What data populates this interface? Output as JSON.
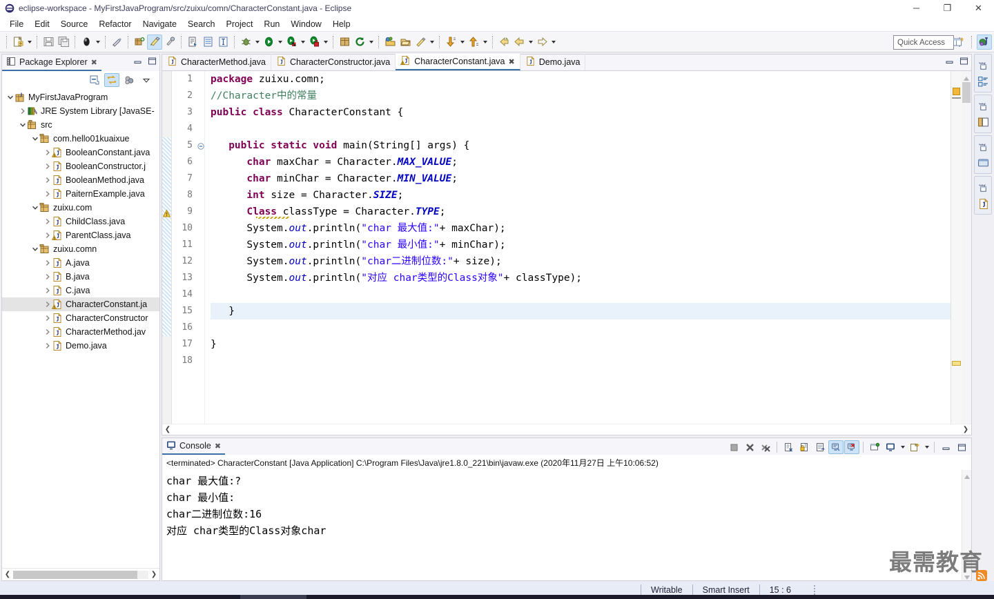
{
  "window": {
    "title": "eclipse-workspace - MyFirstJavaProgram/src/zuixu/comn/CharacterConstant.java - Eclipse",
    "app_icon": "eclipse-icon",
    "minimize_label": "─",
    "maximize_label": "❐",
    "close_label": "✕"
  },
  "menubar": {
    "items": [
      "File",
      "Edit",
      "Source",
      "Refactor",
      "Navigate",
      "Search",
      "Project",
      "Run",
      "Window",
      "Help"
    ]
  },
  "toolbar": {
    "quick_access_placeholder": "Quick Access",
    "groups": [
      {
        "buttons": [
          {
            "name": "new-wizard-icon",
            "caret": true
          }
        ]
      },
      {
        "buttons": [
          {
            "name": "save-icon",
            "caret": false
          },
          {
            "name": "save-all-icon",
            "caret": false
          }
        ]
      },
      {
        "buttons": [
          {
            "name": "print-icon",
            "caret": true
          }
        ]
      },
      {
        "buttons": [
          {
            "name": "toggle-mark-occurrences-icon",
            "caret": false
          }
        ]
      },
      {
        "buttons": [
          {
            "name": "new-java-project-icon",
            "caret": false
          },
          {
            "name": "new-java-class-icon",
            "caret": false,
            "selected": true
          },
          {
            "name": "new-java-package-icon",
            "caret": false
          }
        ]
      },
      {
        "buttons": [
          {
            "name": "open-type-icon",
            "caret": false
          },
          {
            "name": "open-task-icon",
            "caret": false
          },
          {
            "name": "toggle-block-selection-icon",
            "caret": false
          }
        ]
      },
      {
        "buttons": [
          {
            "name": "debug-icon",
            "caret": true
          },
          {
            "name": "run-icon",
            "caret": true
          },
          {
            "name": "run-external-tools-icon",
            "caret": true
          },
          {
            "name": "coverage-icon",
            "caret": true
          }
        ]
      },
      {
        "buttons": [
          {
            "name": "new-package-icon",
            "caret": false
          },
          {
            "name": "refresh-icon",
            "caret": true
          }
        ]
      },
      {
        "buttons": [
          {
            "name": "open-perspective-icon",
            "caret": false
          },
          {
            "name": "open-task-repository-icon",
            "caret": false
          },
          {
            "name": "new-annotation-icon",
            "caret": true
          }
        ]
      },
      {
        "buttons": [
          {
            "name": "next-annotation-icon",
            "caret": true
          },
          {
            "name": "previous-annotation-icon",
            "caret": true
          }
        ]
      },
      {
        "buttons": [
          {
            "name": "back-icon",
            "caret": false
          },
          {
            "name": "previous-edit-icon",
            "caret": true
          },
          {
            "name": "forward-icon",
            "caret": true
          }
        ]
      }
    ],
    "right_buttons": [
      {
        "name": "new-perspective-icon"
      },
      {
        "name": "java-perspective-icon",
        "selected": true
      }
    ]
  },
  "package_explorer": {
    "tab_label": "Package Explorer",
    "tab_icon": "package-explorer-icon",
    "close_icon": "close-icon",
    "minimize_icon": "minimize-icon",
    "maximize_icon": "maximize-icon",
    "toolbar": [
      {
        "name": "collapse-all-icon",
        "selected": false
      },
      {
        "name": "link-with-editor-icon",
        "selected": true
      },
      {
        "name": "focus-on-active-task-icon",
        "selected": false
      },
      {
        "name": "view-menu-icon",
        "selected": false
      }
    ],
    "tree": [
      {
        "depth": 0,
        "arrow": "down",
        "icon": "java-project-icon",
        "label": "MyFirstJavaProgram",
        "selected": false
      },
      {
        "depth": 1,
        "arrow": "right",
        "icon": "library-icon",
        "label": "JRE System Library [JavaSE-",
        "selected": false
      },
      {
        "depth": 1,
        "arrow": "down",
        "icon": "source-folder-icon",
        "label": "src",
        "selected": false
      },
      {
        "depth": 2,
        "arrow": "down",
        "icon": "package-icon",
        "label": "com.hello01kuaixue",
        "selected": false
      },
      {
        "depth": 3,
        "arrow": "right",
        "icon": "java-file-warning-icon",
        "label": "BooleanConstant.java",
        "selected": false
      },
      {
        "depth": 3,
        "arrow": "right",
        "icon": "java-file-icon",
        "label": "BooleanConstructor.j",
        "selected": false
      },
      {
        "depth": 3,
        "arrow": "right",
        "icon": "java-file-icon",
        "label": "BooleanMethod.java",
        "selected": false
      },
      {
        "depth": 3,
        "arrow": "right",
        "icon": "java-file-icon",
        "label": "PaiternExample.java",
        "selected": false
      },
      {
        "depth": 2,
        "arrow": "down",
        "icon": "package-icon",
        "label": "zuixu.com",
        "selected": false
      },
      {
        "depth": 3,
        "arrow": "right",
        "icon": "java-file-icon",
        "label": "ChildClass.java",
        "selected": false
      },
      {
        "depth": 3,
        "arrow": "right",
        "icon": "java-file-warning-icon",
        "label": "ParentClass.java",
        "selected": false
      },
      {
        "depth": 2,
        "arrow": "down",
        "icon": "package-icon",
        "label": "zuixu.comn",
        "selected": false
      },
      {
        "depth": 3,
        "arrow": "right",
        "icon": "java-file-icon",
        "label": "A.java",
        "selected": false
      },
      {
        "depth": 3,
        "arrow": "right",
        "icon": "java-file-icon",
        "label": "B.java",
        "selected": false
      },
      {
        "depth": 3,
        "arrow": "right",
        "icon": "java-file-icon",
        "label": "C.java",
        "selected": false
      },
      {
        "depth": 3,
        "arrow": "right",
        "icon": "java-file-warning-icon",
        "label": "CharacterConstant.ja",
        "selected": true
      },
      {
        "depth": 3,
        "arrow": "right",
        "icon": "java-file-icon",
        "label": "CharacterConstructor",
        "selected": false
      },
      {
        "depth": 3,
        "arrow": "right",
        "icon": "java-file-icon",
        "label": "CharacterMethod.jav",
        "selected": false
      },
      {
        "depth": 3,
        "arrow": "right",
        "icon": "java-file-icon",
        "label": "Demo.java",
        "selected": false
      }
    ],
    "scroll_left_icon": "chevron-left-icon",
    "scroll_right_icon": "chevron-right-icon"
  },
  "editor": {
    "tabs": [
      {
        "label": "CharacterMethod.java",
        "icon": "java-file-icon",
        "active": false,
        "closable": false
      },
      {
        "label": "CharacterConstructor.java",
        "icon": "java-file-icon",
        "active": false,
        "closable": false
      },
      {
        "label": "CharacterConstant.java",
        "icon": "java-file-warning-icon",
        "active": true,
        "closable": true
      },
      {
        "label": "Demo.java",
        "icon": "java-file-icon",
        "active": false,
        "closable": false
      }
    ],
    "close_icon": "close-icon",
    "minimize_icon": "minimize-icon",
    "maximize_icon": "maximize-icon",
    "line_numbers": [
      "1",
      "2",
      "3",
      "4",
      "5",
      "6",
      "7",
      "8",
      "9",
      "10",
      "11",
      "12",
      "13",
      "14",
      "15",
      "16",
      "17",
      "18"
    ],
    "highlighted_line": 15,
    "fold_line": 5,
    "warning_line": 9,
    "lines": [
      {
        "n": 1,
        "tokens": [
          {
            "t": "package ",
            "c": "kw"
          },
          {
            "t": "zuixu.comn;",
            "c": "pl"
          }
        ]
      },
      {
        "n": 2,
        "tokens": [
          {
            "t": "//Character中的常量",
            "c": "cmt"
          }
        ]
      },
      {
        "n": 3,
        "tokens": [
          {
            "t": "public class ",
            "c": "kw"
          },
          {
            "t": "CharacterConstant {",
            "c": "pl"
          }
        ]
      },
      {
        "n": 4,
        "tokens": [
          {
            "t": "",
            "c": "pl"
          }
        ]
      },
      {
        "n": 5,
        "tokens": [
          {
            "t": "   ",
            "c": "pl"
          },
          {
            "t": "public static void ",
            "c": "kw"
          },
          {
            "t": "main(String[] args) {",
            "c": "pl"
          }
        ]
      },
      {
        "n": 6,
        "tokens": [
          {
            "t": "      ",
            "c": "pl"
          },
          {
            "t": "char ",
            "c": "kw"
          },
          {
            "t": "maxChar = Character.",
            "c": "pl"
          },
          {
            "t": "MAX_VALUE",
            "c": "fld"
          },
          {
            "t": ";",
            "c": "pl"
          }
        ]
      },
      {
        "n": 7,
        "tokens": [
          {
            "t": "      ",
            "c": "pl"
          },
          {
            "t": "char ",
            "c": "kw"
          },
          {
            "t": "minChar = Character.",
            "c": "pl"
          },
          {
            "t": "MIN_VALUE",
            "c": "fld"
          },
          {
            "t": ";",
            "c": "pl"
          }
        ]
      },
      {
        "n": 8,
        "tokens": [
          {
            "t": "      ",
            "c": "pl"
          },
          {
            "t": "int ",
            "c": "kw"
          },
          {
            "t": "size = Character.",
            "c": "pl"
          },
          {
            "t": "SIZE",
            "c": "fld"
          },
          {
            "t": ";",
            "c": "pl"
          }
        ]
      },
      {
        "n": 9,
        "tokens": [
          {
            "t": "      ",
            "c": "pl"
          },
          {
            "t": "Class",
            "c": "kw"
          },
          {
            "t": " classType = Character.",
            "c": "pl"
          },
          {
            "t": "TYPE",
            "c": "fld"
          },
          {
            "t": ";",
            "c": "pl"
          }
        ]
      },
      {
        "n": 10,
        "tokens": [
          {
            "t": "      System.",
            "c": "pl"
          },
          {
            "t": "out",
            "c": "sfld"
          },
          {
            "t": ".println(",
            "c": "pl"
          },
          {
            "t": "\"char 最大值:\"",
            "c": "str"
          },
          {
            "t": "+ maxChar);",
            "c": "pl"
          }
        ]
      },
      {
        "n": 11,
        "tokens": [
          {
            "t": "      System.",
            "c": "pl"
          },
          {
            "t": "out",
            "c": "sfld"
          },
          {
            "t": ".println(",
            "c": "pl"
          },
          {
            "t": "\"char 最小值:\"",
            "c": "str"
          },
          {
            "t": "+ minChar);",
            "c": "pl"
          }
        ]
      },
      {
        "n": 12,
        "tokens": [
          {
            "t": "      System.",
            "c": "pl"
          },
          {
            "t": "out",
            "c": "sfld"
          },
          {
            "t": ".println(",
            "c": "pl"
          },
          {
            "t": "\"char二进制位数:\"",
            "c": "str"
          },
          {
            "t": "+ size);",
            "c": "pl"
          }
        ]
      },
      {
        "n": 13,
        "tokens": [
          {
            "t": "      System.",
            "c": "pl"
          },
          {
            "t": "out",
            "c": "sfld"
          },
          {
            "t": ".println(",
            "c": "pl"
          },
          {
            "t": "\"对应 char类型的Class对象\"",
            "c": "str"
          },
          {
            "t": "+ classType);",
            "c": "pl"
          }
        ]
      },
      {
        "n": 14,
        "tokens": [
          {
            "t": "",
            "c": "pl"
          }
        ]
      },
      {
        "n": 15,
        "tokens": [
          {
            "t": "   }",
            "c": "pl"
          }
        ]
      },
      {
        "n": 16,
        "tokens": [
          {
            "t": "",
            "c": "pl"
          }
        ]
      },
      {
        "n": 17,
        "tokens": [
          {
            "t": "}",
            "c": "pl"
          }
        ]
      },
      {
        "n": 18,
        "tokens": [
          {
            "t": "",
            "c": "pl"
          }
        ]
      }
    ]
  },
  "console": {
    "tab_label": "Console",
    "tab_icon": "console-icon",
    "close_icon": "close-icon",
    "terminated_text": "<terminated> CharacterConstant [Java Application] C:\\Program Files\\Java\\jre1.8.0_221\\bin\\javaw.exe (2020年11月27日 上午10:06:52)",
    "toolbar": [
      {
        "name": "terminate-icon",
        "selected": false
      },
      {
        "name": "remove-launch-icon",
        "selected": false
      },
      {
        "name": "remove-all-terminated-icon",
        "selected": false
      },
      {
        "name": "clear-console-icon",
        "selected": false
      },
      {
        "name": "scroll-lock-icon",
        "selected": false
      },
      {
        "name": "word-wrap-icon",
        "selected": false
      },
      {
        "name": "show-console-on-output-icon",
        "selected": true
      },
      {
        "name": "show-console-on-error-icon",
        "selected": true
      },
      {
        "name": "pin-console-icon",
        "selected": false
      },
      {
        "name": "display-selected-console-icon",
        "selected": false
      },
      {
        "name": "open-console-icon",
        "selected": false
      },
      {
        "name": "minimize-icon",
        "selected": false
      },
      {
        "name": "maximize-icon",
        "selected": false
      }
    ],
    "output_lines": [
      "char 最大值:?",
      "char 最小值:",
      "char二进制位数:16",
      "对应 char类型的Class对象char"
    ]
  },
  "fast_view": {
    "groups": [
      {
        "restore_icon": "restore-icon",
        "view_icon": "outline-icon"
      },
      {
        "restore_icon": "restore-icon",
        "view_icon": "package-explorer-icon"
      },
      {
        "restore_icon": "restore-icon",
        "view_icon": "console-view-icon"
      },
      {
        "restore_icon": "restore-icon",
        "view_icon": "java-editor-icon"
      }
    ]
  },
  "statusbar": {
    "writable": "Writable",
    "insert_mode": "Smart Insert",
    "cursor_position": "15 : 6"
  },
  "watermark": {
    "text": "最需教育",
    "badge": "rss-icon"
  },
  "colors": {
    "accent": "#3a6fa5",
    "selection": "#cde3f7",
    "keyword": "#7f0055",
    "string": "#2a00ff",
    "comment": "#3f7f5f",
    "field": "#0000c0",
    "statusbar_bg": "#e8ecf6"
  }
}
